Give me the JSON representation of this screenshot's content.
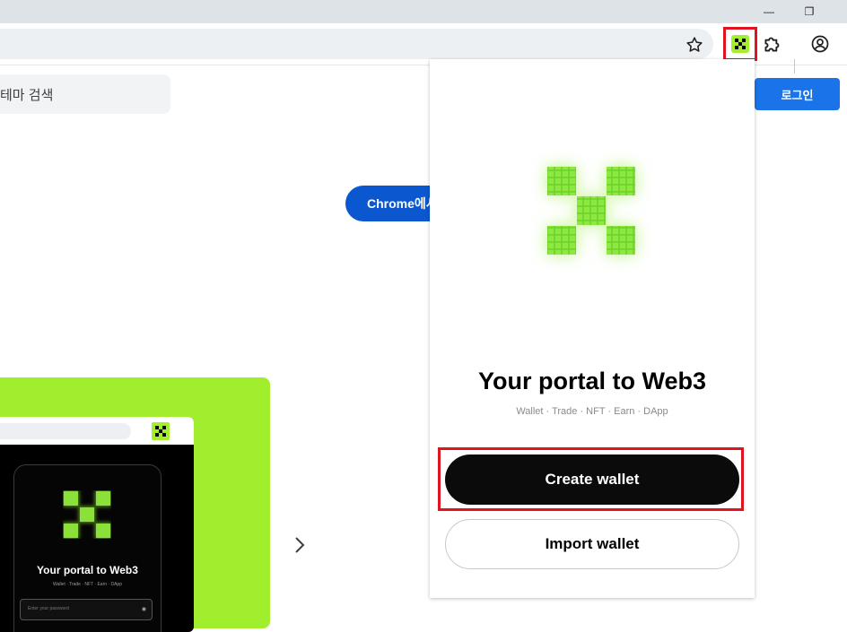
{
  "browser": {
    "window_controls": {
      "minimize_label": "—",
      "restore_label": "❐"
    },
    "toolbar": {
      "bookmark_icon": "star-icon",
      "okx_extension_icon": "okx-extension-icon",
      "extensions_icon": "puzzle-icon",
      "profile_icon": "profile-icon",
      "highlight_color": "#e0141e"
    }
  },
  "page": {
    "search_placeholder": "테마 검색",
    "login_label": "로그인",
    "chrome_button_label": "Chrome에서 사용",
    "next_icon": "chevron-right-icon",
    "promo": {
      "accent_color": "#a0ee2e",
      "mock_title": "Your portal to Web3",
      "mock_subtitle": "Wallet · Trade · NFT · Earn · DApp",
      "mock_input_placeholder": "Enter your password"
    }
  },
  "popup": {
    "logo_icon": "okx-logo-icon",
    "title": "Your portal to Web3",
    "subtitle": "Wallet · Trade · NFT · Earn · DApp",
    "create_wallet_label": "Create wallet",
    "import_wallet_label": "Import wallet",
    "brand_color": "#8be03a"
  }
}
